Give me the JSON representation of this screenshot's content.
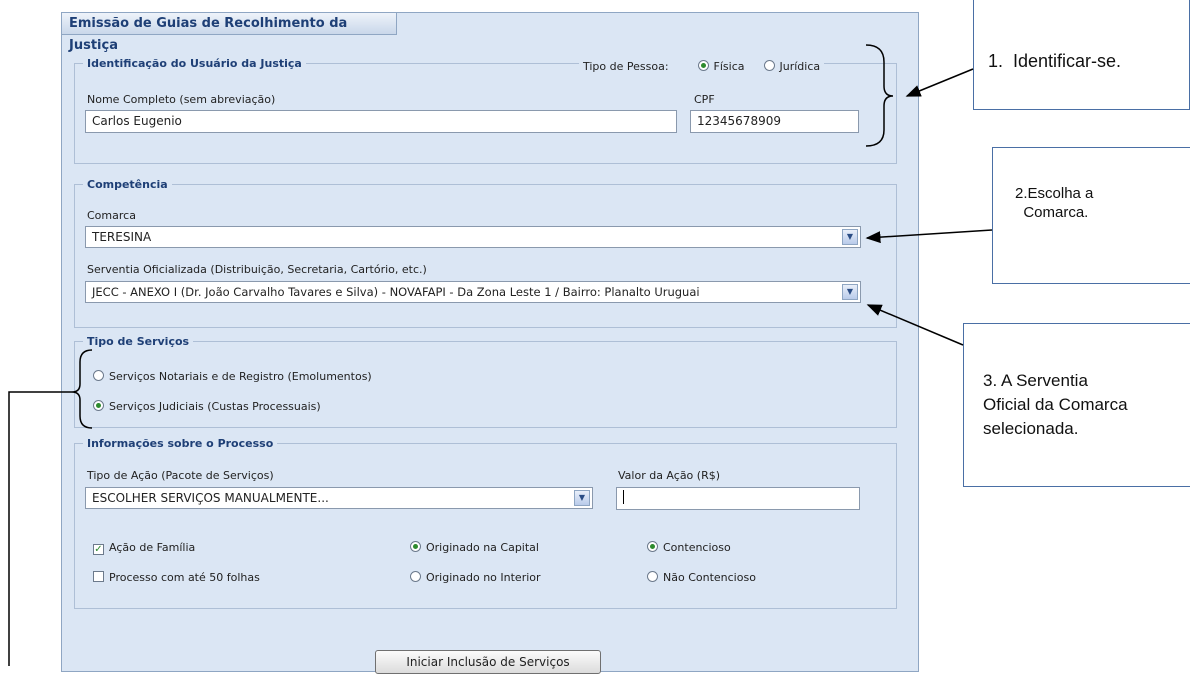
{
  "panel": {
    "title": "Emissão de Guias de Recolhimento da Justiça"
  },
  "identificacao": {
    "legend": "Identificação do Usuário da Justiça",
    "tipo_pessoa_label": "Tipo de Pessoa:",
    "fisica_label": "Física",
    "juridica_label": "Jurídica",
    "selected": "Física",
    "nome_label": "Nome Completo (sem abreviação)",
    "nome_value": "Carlos Eugenio",
    "cpf_label": "CPF",
    "cpf_value": "12345678909"
  },
  "competencia": {
    "legend": "Competência",
    "comarca_label": "Comarca",
    "comarca_value": "TERESINA",
    "serventia_label": "Serventia Oficializada (Distribuição, Secretaria, Cartório, etc.)",
    "serventia_value": "JECC - ANEXO I (Dr. João Carvalho Tavares e Silva) - NOVAFAPI - Da Zona Leste 1 / Bairro: Planalto Uruguai"
  },
  "tipo_servicos": {
    "legend": "Tipo de Serviços",
    "opt1": "Serviços Notariais e de Registro (Emolumentos)",
    "opt2": "Serviços Judiciais (Custas Processuais)",
    "selected": "Serviços Judiciais (Custas Processuais)"
  },
  "processo": {
    "legend": "Informações sobre o Processo",
    "tipo_acao_label": "Tipo de Ação (Pacote de Serviços)",
    "tipo_acao_value": "ESCOLHER SERVIÇOS MANUALMENTE...",
    "valor_label": "Valor da Ação (R$)",
    "valor_value": "",
    "acao_familia": "Ação de Família",
    "acao_familia_checked": true,
    "ate_50_folhas": "Processo com até 50 folhas",
    "ate_50_folhas_checked": false,
    "originado_capital": "Originado na Capital",
    "originado_interior": "Originado no Interior",
    "origem_selected": "Originado na Capital",
    "contencioso": "Contencioso",
    "nao_contencioso": "Não Contencioso",
    "contencioso_selected": "Contencioso"
  },
  "buttons": {
    "iniciar": "Iniciar Inclusão de Serviços"
  },
  "callouts": {
    "c1": "1.  Identificar-se.",
    "c2": "2.Escolha a\n  Comarca.",
    "c3": "3. A Serventia\nOficial da Comarca\nselecionada."
  }
}
